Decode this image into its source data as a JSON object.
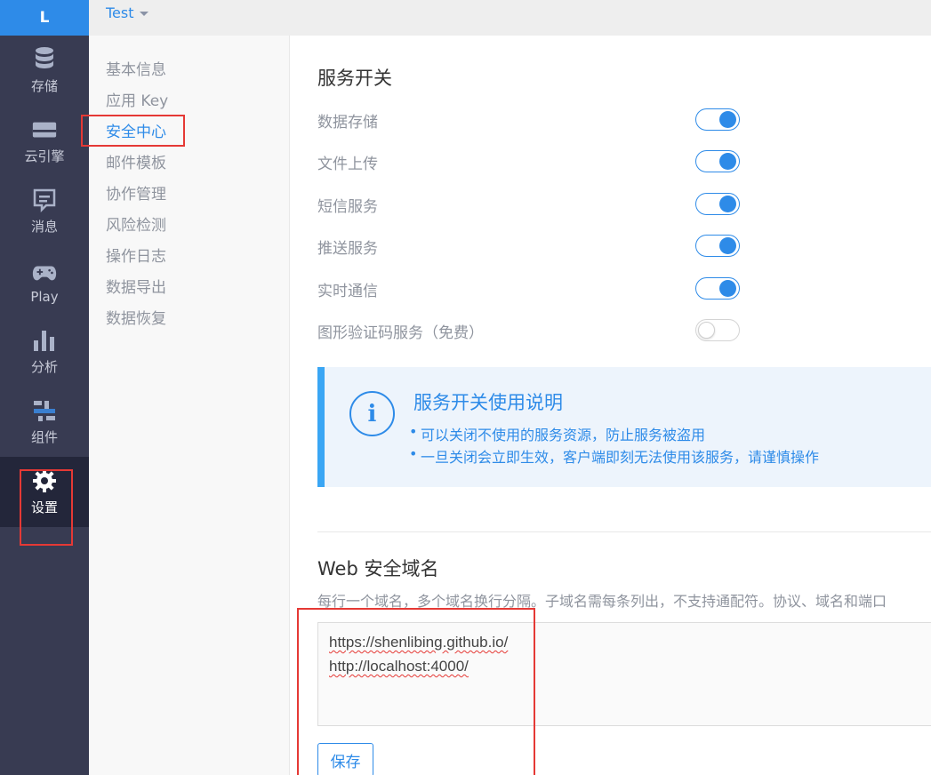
{
  "logo": "L",
  "rail": [
    {
      "label": "存储",
      "icon": "database-icon"
    },
    {
      "label": "云引擎",
      "icon": "server-icon"
    },
    {
      "label": "消息",
      "icon": "message-icon"
    },
    {
      "label": "Play",
      "icon": "gamepad-icon"
    },
    {
      "label": "分析",
      "icon": "bar-chart-icon"
    },
    {
      "label": "组件",
      "icon": "components-icon"
    },
    {
      "label": "设置",
      "icon": "gear-icon",
      "active": true
    }
  ],
  "topbar": {
    "app_name": "Test"
  },
  "subnav": [
    "基本信息",
    "应用 Key",
    "安全中心",
    "邮件模板",
    "协作管理",
    "风险检测",
    "操作日志",
    "数据导出",
    "数据恢复"
  ],
  "subnav_active": "安全中心",
  "switches": {
    "title": "服务开关",
    "items": [
      {
        "label": "数据存储",
        "on": true
      },
      {
        "label": "文件上传",
        "on": true
      },
      {
        "label": "短信服务",
        "on": true
      },
      {
        "label": "推送服务",
        "on": true
      },
      {
        "label": "实时通信",
        "on": true
      },
      {
        "label": "图形验证码服务（免费）",
        "on": false
      }
    ]
  },
  "info": {
    "title": "服务开关使用说明",
    "lines": [
      "可以关闭不使用的服务资源，防止服务被盗用",
      "一旦关闭会立即生效，客户端即刻无法使用该服务，请谨慎操作"
    ]
  },
  "web_domain": {
    "title": "Web 安全域名",
    "desc": "每行一个域名，多个域名换行分隔。子域名需每条列出，不支持通配符。协议、域名和端口",
    "domains": [
      "https://shenlibing.github.io/",
      "http://localhost:4000/"
    ],
    "save_label": "保存"
  },
  "colors": {
    "accent": "#2e8be8",
    "rail": "#383b52",
    "highlight": "#e53935"
  }
}
